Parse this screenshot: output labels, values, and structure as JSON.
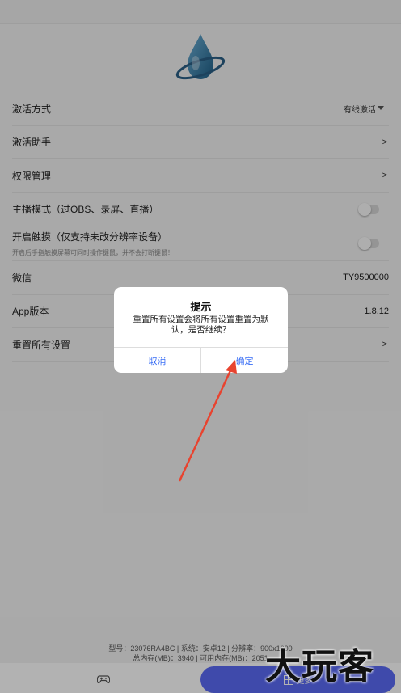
{
  "settings": {
    "activation_mode": {
      "label": "激活方式",
      "value": "有线激活"
    },
    "activation_helper": {
      "label": "激活助手",
      "arrow": ">"
    },
    "permission_mgmt": {
      "label": "权限管理",
      "arrow": ">"
    },
    "streamer_mode": {
      "label": "主播模式（过OBS、录屏、直播）",
      "enabled": false
    },
    "enable_touch": {
      "label": "开启触摸（仅支持未改分辨率设备）",
      "sub": "开启后手指触摸屏幕可同时操作键鼠，并不会打断键鼠！",
      "enabled": false
    },
    "wechat": {
      "label": "微信",
      "value": "TY9500000"
    },
    "app_version": {
      "label": "App版本",
      "value": "1.8.12"
    },
    "reset_all": {
      "label": "重置所有设置",
      "arrow": ">"
    }
  },
  "device_info": {
    "line1": "型号：23076RA4BC | 系统：安卓12 | 分辨率：900x1600",
    "line2": "总内存(MB)：3940 | 可用内存(MB)：2051"
  },
  "tabbar": {
    "left_icon": "gamepad-icon",
    "right_icon": "grid-icon",
    "right_label": "更多"
  },
  "dialog": {
    "title": "提示",
    "message": "重置所有设置会将所有设置重置为默认，是否继续？",
    "cancel_label": "取消",
    "confirm_label": "确定"
  },
  "watermark": "大玩客",
  "colors": {
    "accent": "#5b6bf5",
    "dialog_button": "#3b6ff5",
    "annotation_arrow": "#e8432f"
  }
}
